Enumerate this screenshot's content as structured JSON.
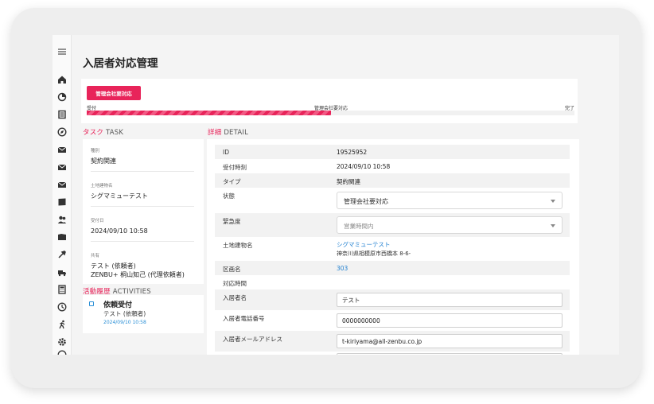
{
  "page": {
    "title": "入居者対応管理"
  },
  "progress": {
    "current_status": "管理会社要対応",
    "steps": [
      "受付",
      "管理会社要対応",
      "完了"
    ],
    "fill_fraction": 0.5
  },
  "sections": {
    "task": {
      "jp": "タスク",
      "en": "TASK"
    },
    "detail": {
      "jp": "詳細",
      "en": "DETAIL"
    },
    "activities": {
      "jp": "活動履歴",
      "en": "ACTIVITIES"
    }
  },
  "task": {
    "items": [
      {
        "label": "種別",
        "value": "契約関連"
      },
      {
        "label": "土地建物名",
        "value": "シグマミューテスト"
      },
      {
        "label": "受付日",
        "value": "2024/09/10 10:58"
      },
      {
        "label": "共有",
        "value": "テスト (依頼者)",
        "value2": "ZENBU+ 桐山知己 (代理依頼者)"
      }
    ]
  },
  "activities": [
    {
      "title": "依頼受付",
      "sub": "テスト (依頼者)",
      "date": "2024/09/10 10:58"
    }
  ],
  "detail": {
    "id": {
      "label": "ID",
      "value": "19525952"
    },
    "received_at": {
      "label": "受付時刻",
      "value": "2024/09/10 10:58"
    },
    "type": {
      "label": "タイプ",
      "value": "契約関連"
    },
    "state": {
      "label": "状態",
      "value": "管理会社要対応"
    },
    "urgency": {
      "label": "緊急度",
      "placeholder": "営業時間内"
    },
    "building": {
      "label": "土地建物名",
      "value": "シグマミューテスト",
      "address": "神奈川県相模原市西橋本 8-6-"
    },
    "unit": {
      "label": "区画名",
      "value": "303"
    },
    "response_time": {
      "label": "対応時間"
    },
    "resident_name": {
      "label": "入居者名",
      "value": "テスト"
    },
    "resident_phone": {
      "label": "入居者電話番号",
      "value": "0000000000"
    },
    "resident_email": {
      "label": "入居者メールアドレス",
      "value": "t-kiriyama@all-zenbu.co.jp"
    }
  },
  "colors": {
    "accent": "#e8245a",
    "link": "#1f7fd0"
  }
}
